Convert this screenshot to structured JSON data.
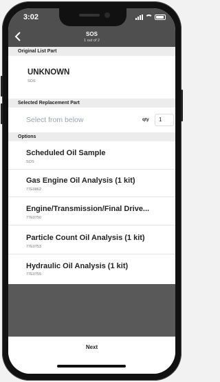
{
  "status_bar": {
    "time": "3:02"
  },
  "nav": {
    "title": "SOS",
    "subtitle": "1 out of 2"
  },
  "original_section": {
    "header": "Original List Part",
    "part_name": "UNKNOWN",
    "part_code": "SOS"
  },
  "replacement_section": {
    "header": "Selected Replacement  Part",
    "placeholder": "Select from below",
    "qty_label": "qty",
    "qty_value": "1"
  },
  "options_section": {
    "header": "Options",
    "items": [
      {
        "title": "Scheduled Oil Sample",
        "code": "SOS"
      },
      {
        "title": "Gas Engine Oil Analysis (1 kit)",
        "code": "77E0862"
      },
      {
        "title": "Engine/Transmission/Final Drive...",
        "code": "77E0750"
      },
      {
        "title": "Particle Count Oil Analysis (1 kit)",
        "code": "77E0753"
      },
      {
        "title": "Hydraulic Oil Analysis (1 kit)",
        "code": "77E0755"
      }
    ]
  },
  "footer": {
    "next_label": "Next"
  },
  "colors": {
    "nav_background": "#4f4f4f",
    "section_header": "#ececec",
    "placeholder_text": "#9aa0b0"
  },
  "icons": {
    "back": "chevron-left-icon",
    "signal": "cellular-signal-icon",
    "wifi": "wifi-icon",
    "battery": "battery-icon"
  }
}
